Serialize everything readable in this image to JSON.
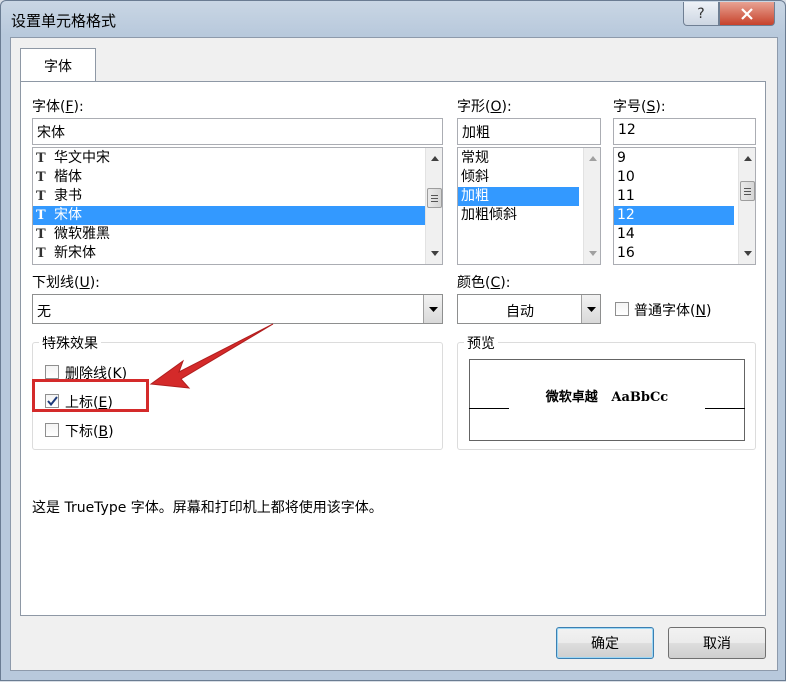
{
  "window": {
    "title": "设置单元格格式",
    "help_label": "?",
    "close_icon": "close-icon"
  },
  "tabs": [
    {
      "label": "字体",
      "active": true
    }
  ],
  "font": {
    "label_prefix": "字体(",
    "label_key": "F",
    "label_suffix": "):",
    "value": "宋体",
    "items": [
      "华文中宋",
      "楷体",
      "隶书",
      "宋体",
      "微软雅黑",
      "新宋体"
    ],
    "selected": "宋体",
    "item_icon": "truetype-icon"
  },
  "style": {
    "label_prefix": "字形(",
    "label_key": "O",
    "label_suffix": "):",
    "value": "加粗",
    "items": [
      "常规",
      "倾斜",
      "加粗",
      "加粗倾斜"
    ],
    "selected": "加粗"
  },
  "size": {
    "label_prefix": "字号(",
    "label_key": "S",
    "label_suffix": "):",
    "value": "12",
    "items": [
      "9",
      "10",
      "11",
      "12",
      "14",
      "16"
    ],
    "selected": "12"
  },
  "underline": {
    "label_prefix": "下划线(",
    "label_key": "U",
    "label_suffix": "):",
    "value": "无"
  },
  "color": {
    "label_prefix": "颜色(",
    "label_key": "C",
    "label_suffix": "):",
    "value": "自动"
  },
  "normal_font": {
    "label_prefix": "普通字体(",
    "label_key": "N",
    "label_suffix": ")",
    "checked": false
  },
  "effects": {
    "caption": "特殊效果",
    "strikethrough": {
      "label_prefix": "删除线(",
      "label_key": "K",
      "label_suffix": ")",
      "checked": false
    },
    "superscript": {
      "label_prefix": "上标(",
      "label_key": "E",
      "label_suffix": ")",
      "checked": true
    },
    "subscript": {
      "label_prefix": "下标(",
      "label_key": "B",
      "label_suffix": ")",
      "checked": false
    }
  },
  "preview": {
    "caption": "预览",
    "sample_cn": "微软卓越",
    "sample_en": "AaBbCc"
  },
  "info_text": "这是 TrueType 字体。屏幕和打印机上都将使用该字体。",
  "buttons": {
    "ok": "确定",
    "cancel": "取消"
  },
  "colors": {
    "selection": "#3399ff",
    "annotation": "#d42a2a"
  }
}
